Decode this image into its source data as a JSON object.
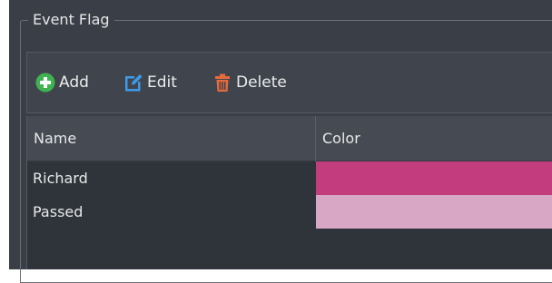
{
  "groupbox": {
    "title": "Event Flag"
  },
  "toolbar": {
    "add_label": "Add",
    "edit_label": "Edit",
    "delete_label": "Delete"
  },
  "table": {
    "columns": [
      "Name",
      "Color"
    ],
    "rows": [
      {
        "name": "Richard",
        "color": "#c33c7e"
      },
      {
        "name": "Passed",
        "color": "#d8a7c6"
      }
    ]
  },
  "icons": {
    "add": "plus-circle-icon",
    "edit": "edit-icon",
    "delete": "trash-icon"
  },
  "colors": {
    "background": "#3a3f47",
    "add_icon": "#3fb34f",
    "edit_icon": "#3d9be9",
    "delete_icon": "#e86a3c"
  }
}
